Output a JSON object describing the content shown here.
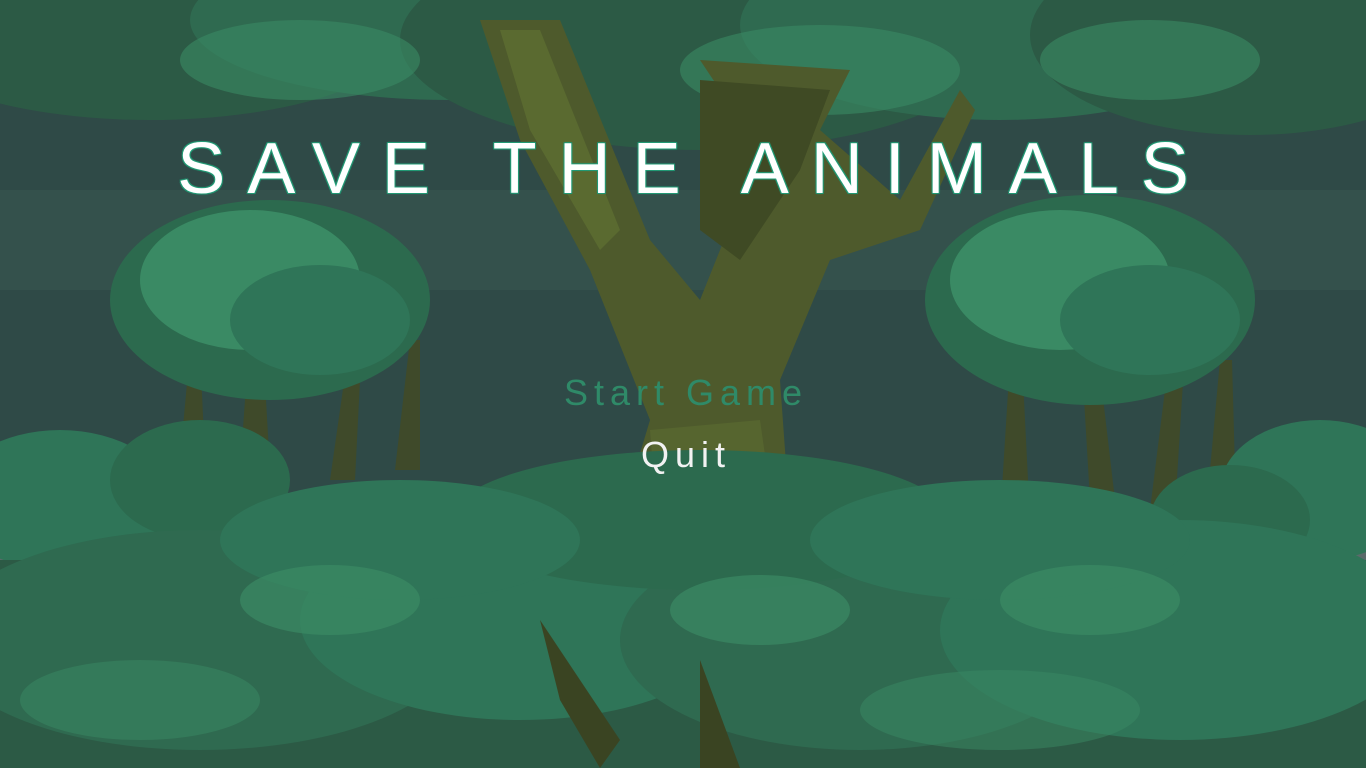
{
  "game": {
    "title": "SAVE THE ANIMALS"
  },
  "menu": {
    "items": [
      {
        "label": "Start Game",
        "state": "highlighted"
      },
      {
        "label": "Quit",
        "state": "normal"
      }
    ]
  },
  "colors": {
    "sky": "#2f4a47",
    "foliage_dark": "#2c5a45",
    "foliage_mid": "#2f7558",
    "foliage_light": "#3a8a64",
    "trunk": "#4e5a2c",
    "rock": "#5a6a6a",
    "title_text": "#ffffff",
    "title_glow": "#1f8c6a",
    "start_text": "#2f8a68",
    "quit_text": "#f2f2f2"
  }
}
